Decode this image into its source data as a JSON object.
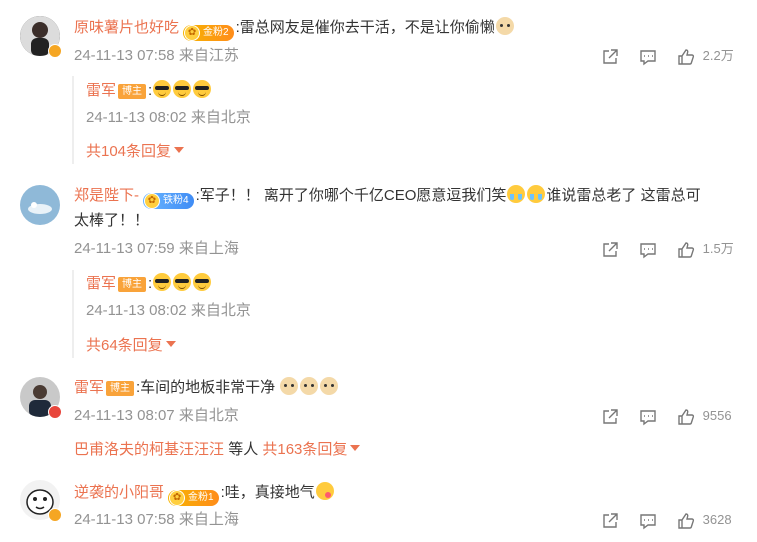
{
  "comments": [
    {
      "username": "原味薯片也好吃",
      "fan_badge": "金粉2",
      "text": ":雷总网友是催你去干活，不是让你偷懒",
      "time": "24-11-13 07:58",
      "location": "来自江苏",
      "likes": "2.2万",
      "reply": {
        "username": "雷军",
        "badge": "博主",
        "text": ":",
        "time": "24-11-13 08:02",
        "location": "来自北京"
      },
      "more_replies": "共104条回复"
    },
    {
      "username": "郑是陛下-",
      "fan_badge": "铁粉4",
      "text1": ":军子！！ 离开了你哪个千亿CEO愿意逗我们笑",
      "text2": "谁说雷总老了 这雷总可",
      "text3": "太棒了！！",
      "time": "24-11-13 07:59",
      "location": "来自上海",
      "likes": "1.5万",
      "reply": {
        "username": "雷军",
        "badge": "博主",
        "text": ":",
        "time": "24-11-13 08:02",
        "location": "来自北京"
      },
      "more_replies": "共64条回复"
    },
    {
      "username": "雷军",
      "badge": "博主",
      "text": ":车间的地板非常干净",
      "time": "24-11-13 08:07",
      "location": "来自北京",
      "likes": "9556",
      "sub_user": "巴甫洛夫的柯基汪汪汪",
      "sub_mid": "等人",
      "sub_count": "共163条回复"
    },
    {
      "username": "逆袭的小阳哥",
      "fan_badge": "金粉1",
      "text": ":哇，真接地气",
      "time": "24-11-13 07:58",
      "location": "来自上海",
      "likes": "3628"
    }
  ],
  "icons": {
    "share": "share-icon",
    "comment": "comment-icon",
    "like": "like-icon"
  },
  "colors": {
    "username": "#eb7350",
    "meta": "#939393",
    "text": "#333333",
    "bozhu_badge": "#f9a33a"
  }
}
